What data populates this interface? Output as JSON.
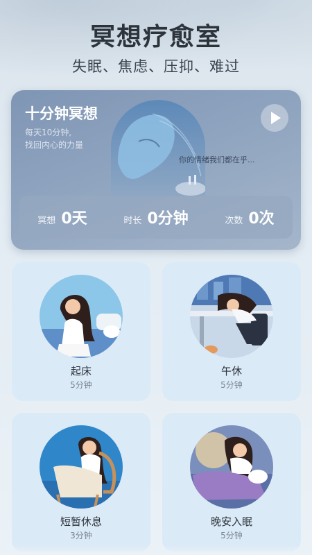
{
  "header": {
    "title": "冥想疗愈室",
    "subtitle": "失眠、焦虑、压抑、难过"
  },
  "hero": {
    "title": "十分钟冥想",
    "desc_line1": "每天10分钟,",
    "desc_line2": "找回内心的力量",
    "caption": "你的情绪我们都在乎...",
    "play_icon": "play-icon",
    "stats": [
      {
        "label": "冥想",
        "value": "0天"
      },
      {
        "label": "时长",
        "value": "0分钟"
      },
      {
        "label": "次数",
        "value": "0次"
      }
    ]
  },
  "sessions": [
    {
      "name": "起床",
      "duration": "5分钟"
    },
    {
      "name": "午休",
      "duration": "5分钟"
    },
    {
      "name": "短暂休息",
      "duration": "3分钟"
    },
    {
      "name": "晚安入眠",
      "duration": "5分钟"
    }
  ],
  "colors": {
    "card_bg": "#dbeaf7",
    "hero_bg": "#8fa4bf",
    "text_primary": "#2c333b"
  }
}
